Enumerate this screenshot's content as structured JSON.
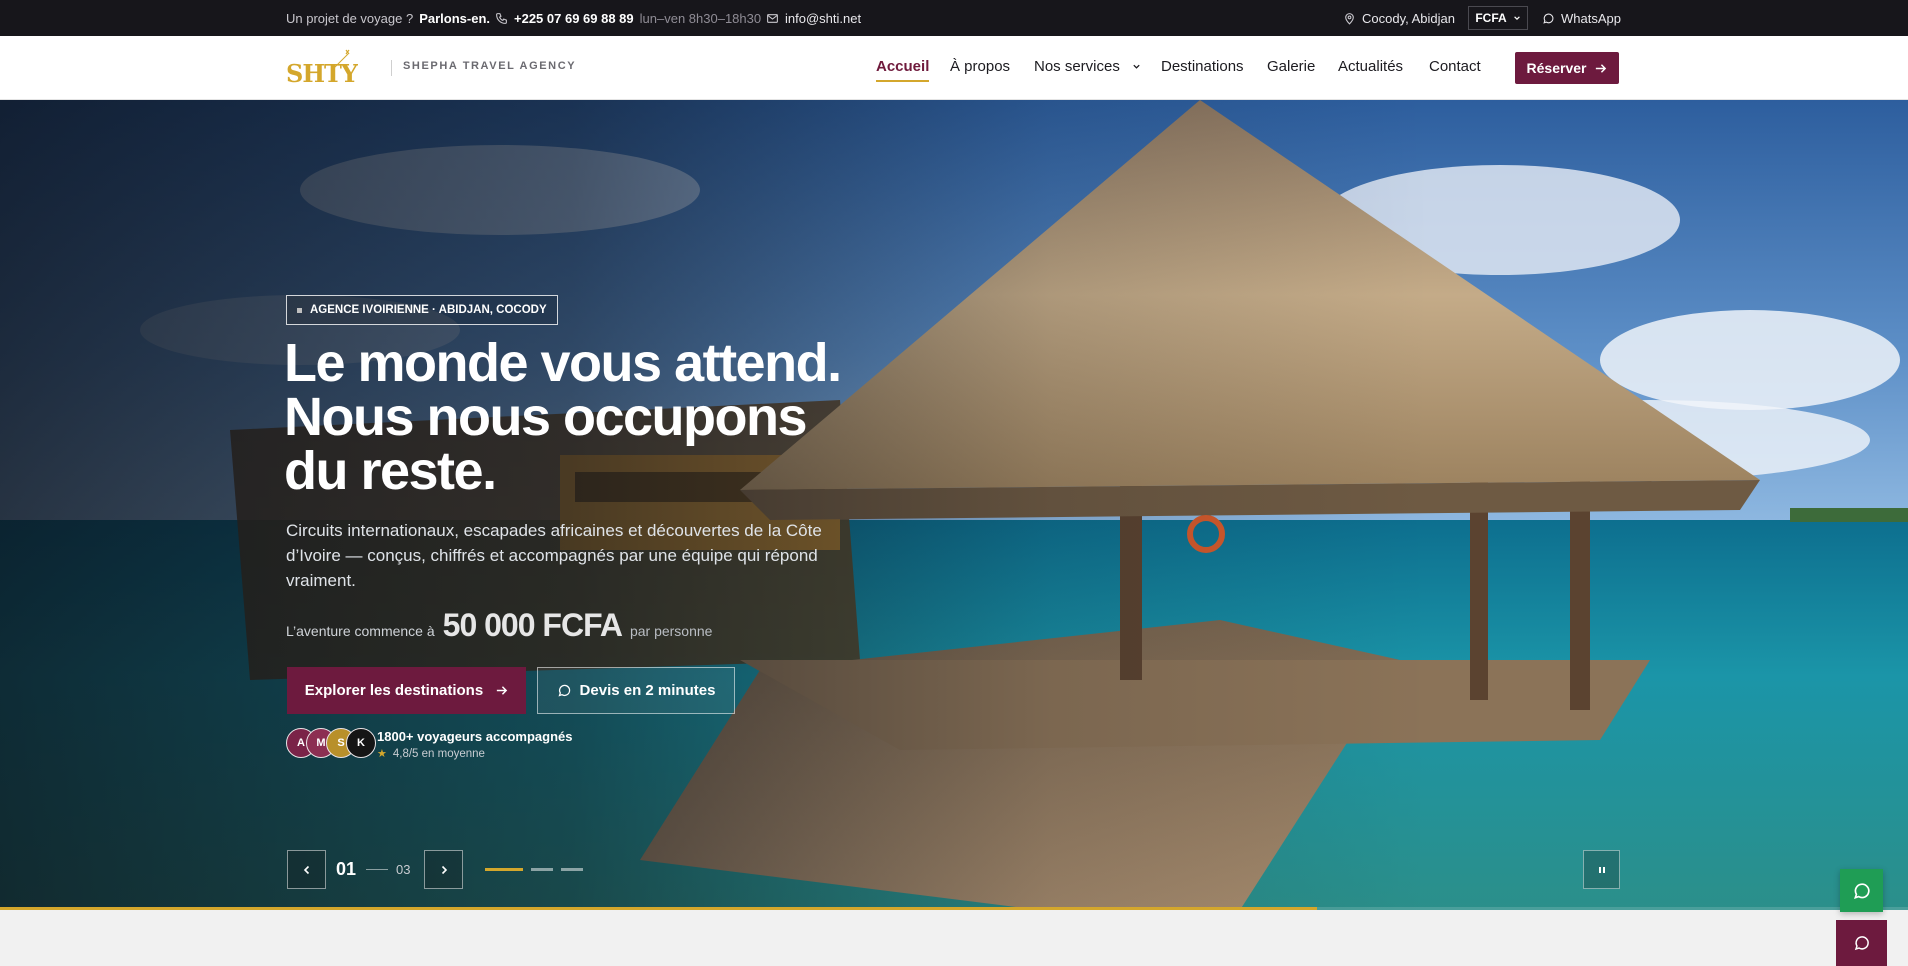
{
  "topbar": {
    "prompt_text": "Un projet de voyage ?",
    "prompt_link": "Parlons-en.",
    "phone": "+225 07 69 69 88 89",
    "hours": "lun–ven 8h30–18h30",
    "email": "info@shti.net",
    "location": "Cocody, Abidjan",
    "currency": "FCFA",
    "whatsapp": "WhatsApp"
  },
  "brand": {
    "logo_text": "SHTY",
    "tagline": "SHEPHA TRAVEL AGENCY",
    "accent": "#6d1a3e",
    "gold": "#d4a72c"
  },
  "nav": {
    "items": [
      {
        "label": "Accueil",
        "active": true
      },
      {
        "label": "À propos"
      },
      {
        "label": "Nos services",
        "has_dropdown": true
      },
      {
        "label": "Destinations"
      },
      {
        "label": "Galerie"
      },
      {
        "label": "Actualités"
      },
      {
        "label": "Contact"
      }
    ],
    "cta": "Réserver"
  },
  "hero": {
    "badge": "AGENCE IVOIRIENNE · ABIDJAN, COCODY",
    "headline": [
      "Le monde vous attend.",
      "Nous nous occupons",
      "du reste."
    ],
    "lede": "Circuits internationaux, escapades africaines et découvertes de la Côte d’Ivoire — conçus, chiffrés et accompagnés par une équipe qui répond vraiment.",
    "price_prefix": "L’aventure commence à",
    "price_amount": "50 000 FCFA",
    "price_suffix": "par personne",
    "primary_cta": "Explorer les destinations",
    "secondary_cta": "Devis en 2 minutes",
    "avatars": [
      {
        "initial": "A",
        "color": "#7a2348"
      },
      {
        "initial": "M",
        "color": "#8c2f52"
      },
      {
        "initial": "S",
        "color": "#b8902a"
      },
      {
        "initial": "K",
        "color": "#151515"
      }
    ],
    "social_title": "1800+ voyageurs accompagnés",
    "social_rating": "4,8/5 en moyenne",
    "slide_current": "01",
    "slide_total": "03",
    "slide_progress": 0.69
  }
}
